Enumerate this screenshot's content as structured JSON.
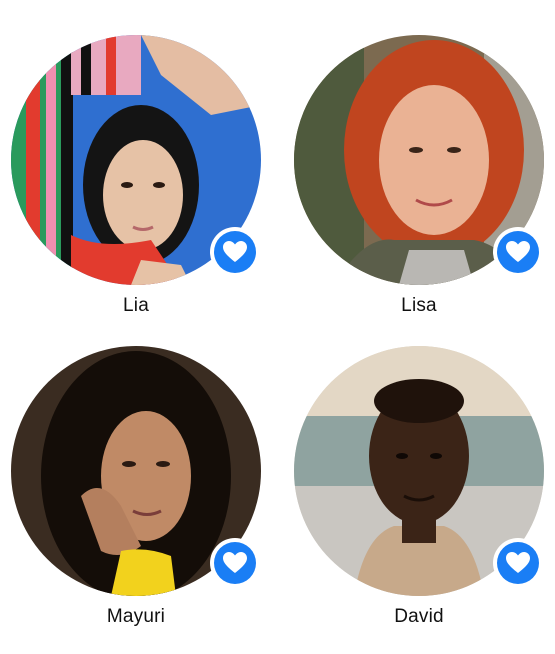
{
  "contacts": [
    {
      "name": "Lia",
      "avatar_icon": "portrait-photo",
      "favorite": true,
      "favorite_icon": "heart-icon"
    },
    {
      "name": "Lisa",
      "avatar_icon": "portrait-photo",
      "favorite": true,
      "favorite_icon": "heart-icon"
    },
    {
      "name": "Mayuri",
      "avatar_icon": "portrait-photo",
      "favorite": true,
      "favorite_icon": "heart-icon"
    },
    {
      "name": "David",
      "avatar_icon": "portrait-photo",
      "favorite": true,
      "favorite_icon": "heart-icon"
    }
  ],
  "colors": {
    "accent": "#1a7ef5",
    "background": "#ffffff",
    "name_text": "#111111"
  }
}
